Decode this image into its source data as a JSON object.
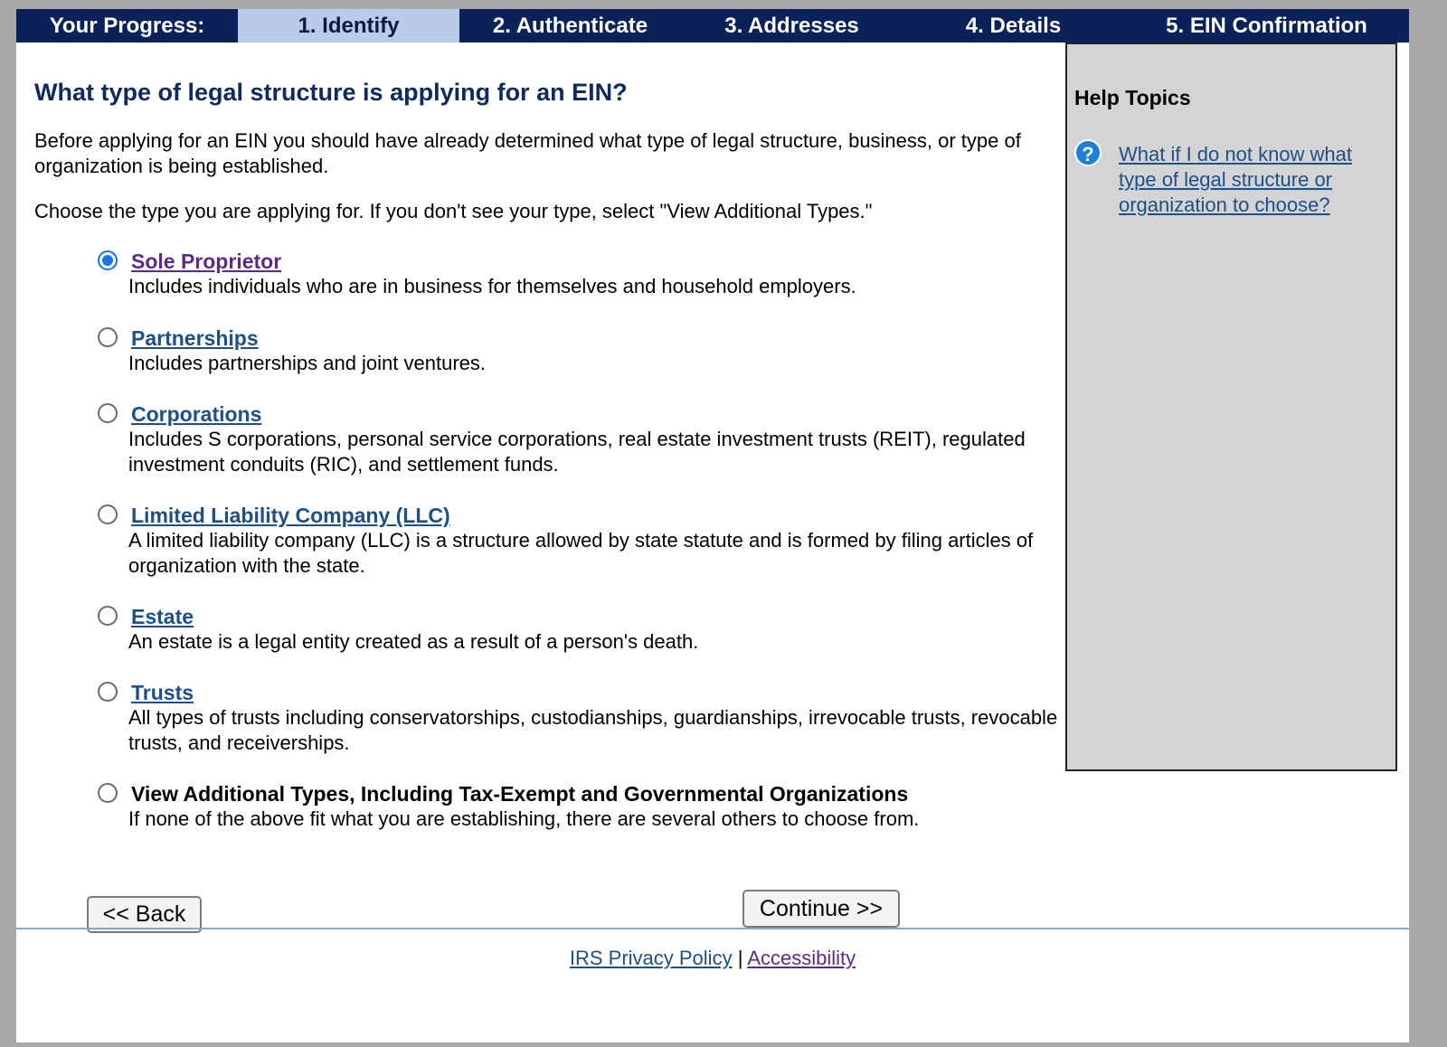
{
  "progress": {
    "label": "Your Progress:",
    "steps": [
      {
        "label": "1. Identify",
        "active": true
      },
      {
        "label": "2. Authenticate",
        "active": false
      },
      {
        "label": "3. Addresses",
        "active": false
      },
      {
        "label": "4. Details",
        "active": false
      },
      {
        "label": "5. EIN Confirmation",
        "active": false
      }
    ]
  },
  "main": {
    "question": "What type of legal structure is applying for an EIN?",
    "intro": "Before applying for an EIN you should have already determined what type of legal structure, business, or type of organization is being established.",
    "instruction": "Choose the type you are applying for. If you don't see your type, select \"View Additional Types.\"",
    "options": [
      {
        "title": "Sole Proprietor",
        "description": "Includes individuals who are in business for themselves and household employers.",
        "selected": true
      },
      {
        "title": "Partnerships",
        "description": "Includes partnerships and joint ventures.",
        "selected": false
      },
      {
        "title": "Corporations",
        "description": "Includes S corporations, personal service corporations, real estate investment trusts (REIT), regulated investment conduits (RIC), and settlement funds.",
        "selected": false
      },
      {
        "title": "Limited Liability Company (LLC)",
        "description": "A limited liability company (LLC) is a structure allowed by state statute and is formed by filing articles of organization with the state.",
        "selected": false
      },
      {
        "title": "Estate",
        "description": "An estate is a legal entity created as a result of a person's death.",
        "selected": false
      },
      {
        "title": "Trusts",
        "description": "All types of trusts including conservatorships, custodianships, guardianships, irrevocable trusts, revocable trusts, and receiverships.",
        "selected": false
      },
      {
        "title": "View Additional Types, Including Tax-Exempt and Governmental Organizations",
        "description": "If none of the above fit what you are establishing, there are several others to choose from.",
        "selected": false
      }
    ]
  },
  "help": {
    "title": "Help Topics",
    "icon": "question-icon",
    "link": "What if I do not know what type of legal structure or organization to choose?"
  },
  "buttons": {
    "back": "<< Back",
    "continue": "Continue >>"
  },
  "footer": {
    "privacy": "IRS Privacy Policy",
    "separator": "|",
    "accessibility": "Accessibility"
  },
  "colors": {
    "progress_bg": "#0a2159",
    "progress_active": "#b9cbeb",
    "heading": "#0f2a5c",
    "link": "#1e4f87",
    "link_visited": "#5e2a84",
    "help_panel_bg": "#d4d4d4",
    "radio_checked": "#1a73e8"
  }
}
